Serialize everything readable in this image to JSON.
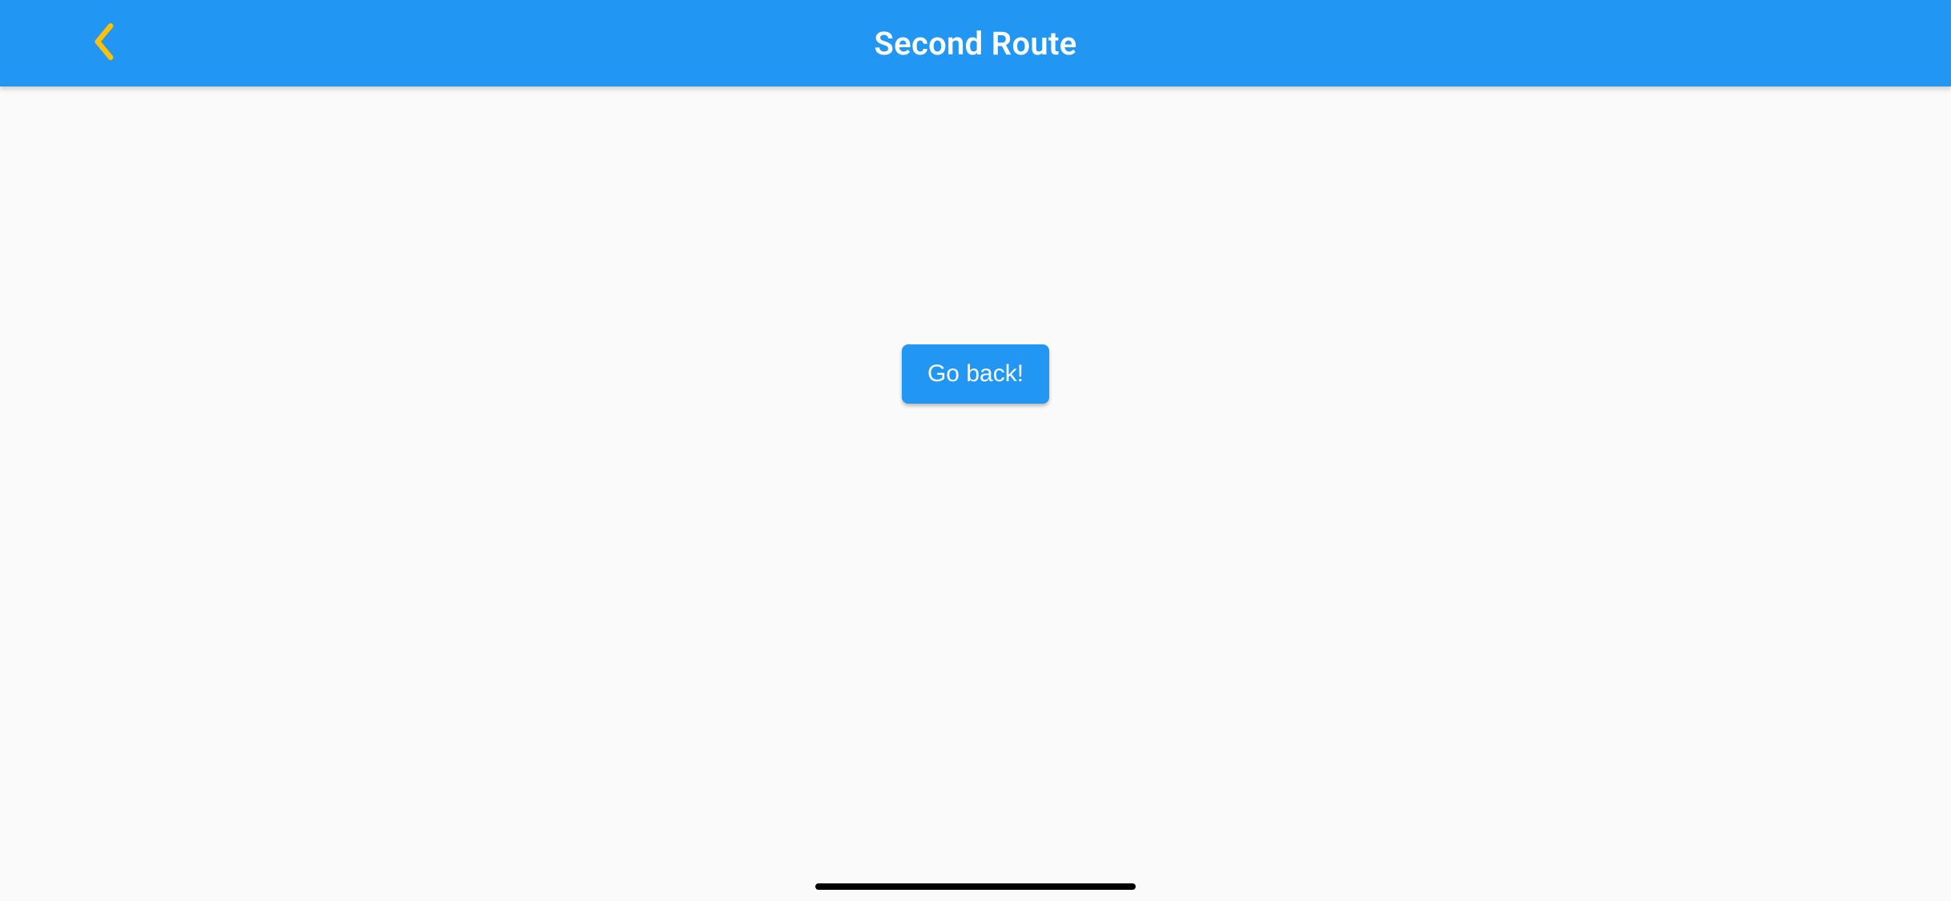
{
  "appBar": {
    "title": "Second Route"
  },
  "main": {
    "goBackLabel": "Go back!"
  }
}
